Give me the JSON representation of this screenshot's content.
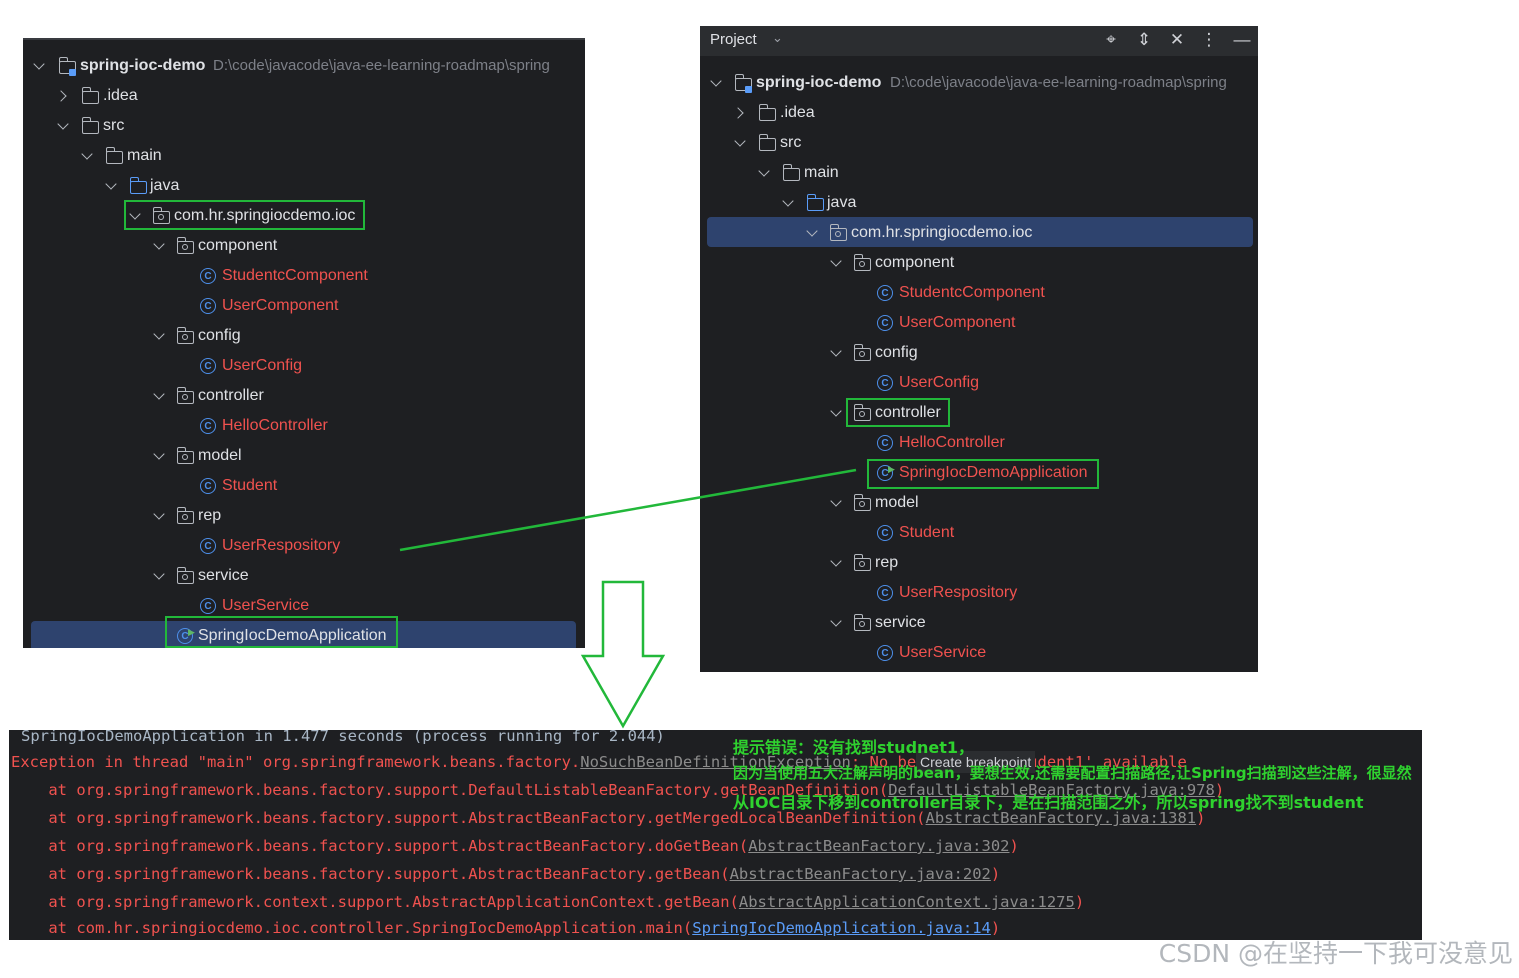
{
  "left_tree": {
    "project_name": "spring-ioc-demo",
    "project_path": "D:\\code\\javacode\\java-ee-learning-roadmap\\spring",
    "items": [
      {
        "label": "spring-ioc-demo"
      },
      {
        "label": ".idea"
      },
      {
        "label": "src"
      },
      {
        "label": "main"
      },
      {
        "label": "java"
      },
      {
        "label": "com.hr.springiocdemo.ioc"
      },
      {
        "label": "component"
      },
      {
        "label": "StudentcComponent"
      },
      {
        "label": "UserComponent"
      },
      {
        "label": "config"
      },
      {
        "label": "UserConfig"
      },
      {
        "label": "controller"
      },
      {
        "label": "HelloController"
      },
      {
        "label": "model"
      },
      {
        "label": "Student"
      },
      {
        "label": "rep"
      },
      {
        "label": "UserRespository"
      },
      {
        "label": "service"
      },
      {
        "label": "UserService"
      },
      {
        "label": "SpringIocDemoApplication"
      }
    ]
  },
  "right_tree": {
    "header_title": "Project",
    "header_icons": [
      "crosshair-icon",
      "expand-icon",
      "collapse-icon",
      "more-icon",
      "minimize-icon"
    ],
    "project_name": "spring-ioc-demo",
    "project_path": "D:\\code\\javacode\\java-ee-learning-roadmap\\spring",
    "items": [
      {
        "label": "spring-ioc-demo"
      },
      {
        "label": ".idea"
      },
      {
        "label": "src"
      },
      {
        "label": "main"
      },
      {
        "label": "java"
      },
      {
        "label": "com.hr.springiocdemo.ioc"
      },
      {
        "label": "component"
      },
      {
        "label": "StudentcComponent"
      },
      {
        "label": "UserComponent"
      },
      {
        "label": "config"
      },
      {
        "label": "UserConfig"
      },
      {
        "label": "controller"
      },
      {
        "label": "HelloController"
      },
      {
        "label": "SpringIocDemoApplication"
      },
      {
        "label": "model"
      },
      {
        "label": "Student"
      },
      {
        "label": "rep"
      },
      {
        "label": "UserRespository"
      },
      {
        "label": "service"
      },
      {
        "label": "UserService"
      }
    ]
  },
  "console": {
    "line0": "SpringIocDemoApplication in 1.477 seconds (process running for 2.044)",
    "line1_prefix": "Exception in thread \"main\" org.springframework.beans.factory.",
    "line1_exception": "NoSuchBeanDefinitionException",
    "breakpoint_label": "Create breakpoint",
    "line1_suffix": ": No bean named 'student1' available",
    "line2_prefix": "    at org.springframework.beans.factory.support.DefaultListableBeanFactory.getBeanDefinition(",
    "line2_link": "DefaultListableBeanFactory.java:978",
    "line3_prefix": "    at org.springframework.beans.factory.support.AbstractBeanFactory.getMergedLocalBeanDefinition(",
    "line3_link": "AbstractBeanFactory.java:1381",
    "line4_prefix": "    at org.springframework.beans.factory.support.AbstractBeanFactory.doGetBean(",
    "line4_link": "AbstractBeanFactory.java:302",
    "line5_prefix": "    at org.springframework.beans.factory.support.AbstractBeanFactory.getBean(",
    "line5_link": "AbstractBeanFactory.java:202",
    "line6_prefix": "    at org.springframework.context.support.AbstractApplicationContext.getBean(",
    "line6_link": "AbstractApplicationContext.java:1275",
    "line7_prefix": "    at com.hr.springiocdemo.ioc.controller.SpringIocDemoApplication.main(",
    "line7_link": "SpringIocDemoApplication.java:14",
    "close_paren": ")"
  },
  "annotation": {
    "line1": "提示错误：没有找到studnet1，",
    "line2": "因为当使用五大注解声明的bean，要想生效,还需要配置扫描路径,让Spring扫描到这些注解，很显然",
    "line3": "从IOC目录下移到controller目录下，是在扫描范围之外，所以spring找不到student"
  },
  "watermark": "CSDN @在坚持一下我可没意见",
  "colors": {
    "panel_bg": "#1e1f22",
    "class_text": "#f0524f",
    "highlight_green": "#22b83a",
    "selection": "#2e436e"
  }
}
